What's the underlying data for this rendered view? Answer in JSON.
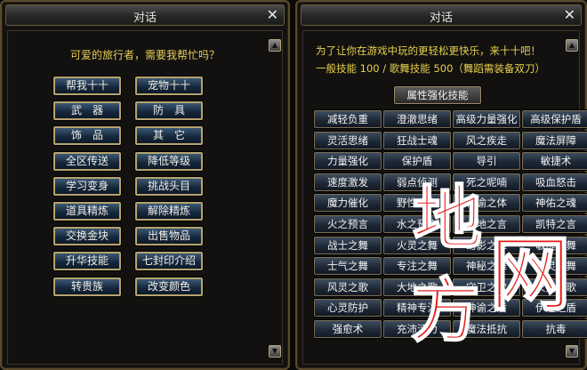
{
  "left_panel": {
    "title": "对话",
    "close": "✕",
    "greeting": "可爱的旅行者，需要我帮忙吗？",
    "buttons": [
      "帮我十十",
      "宠物十十",
      "武　器",
      "防　具",
      "饰　品",
      "其　它",
      "全区传送",
      "降低等级",
      "学习变身",
      "挑战头目",
      "道具精炼",
      "解除精炼",
      "交换金块",
      "出售物品",
      "升华技能",
      "七封印介绍",
      "转贵族",
      "改变颜色"
    ]
  },
  "right_panel": {
    "title": "对话",
    "close": "✕",
    "intro_line1": "为了让你在游戏中玩的更轻松更快乐，来十十吧！",
    "intro_line2": "一般技能 100 / 歌舞技能 500（舞蹈需装备双刀）",
    "attr_button": "属性强化技能",
    "skills": [
      "减轻负重",
      "澄澈思绪",
      "高级力量强化",
      "高级保护盾",
      "灵活思绪",
      "狂战士魂",
      "风之疾走",
      "魔法屏障",
      "力量强化",
      "保护盾",
      "导引",
      "敏捷术",
      "速度激发",
      "弱点侦测",
      "死之呢喃",
      "吸血怒击",
      "魔力催化",
      "野性魔力",
      "神谕之体",
      "神佑之魂",
      "火之预言",
      "水之预言",
      "大地之言",
      "凯特之言",
      "战士之舞",
      "火灵之舞",
      "幻影之舞",
      "敏捷之舞",
      "士气之舞",
      "专注之舞",
      "神秘之舞",
      "水灵之舞",
      "风灵之歌",
      "大地之歌",
      "守卫之歌",
      "火灵之歌",
      "心灵防护",
      "精神专注",
      "神谕之盾",
      "伊娃之盾",
      "强愈术",
      "充沛活力",
      "魔法抵抗",
      "抗毒"
    ]
  },
  "watermark": {
    "chars": [
      "地",
      "方",
      "网"
    ],
    "color": "#e01a1a"
  },
  "icons": {
    "scroll_up": "scroll-up-arrow-icon",
    "scroll_down": "scroll-down-arrow-icon",
    "close": "close-icon"
  }
}
